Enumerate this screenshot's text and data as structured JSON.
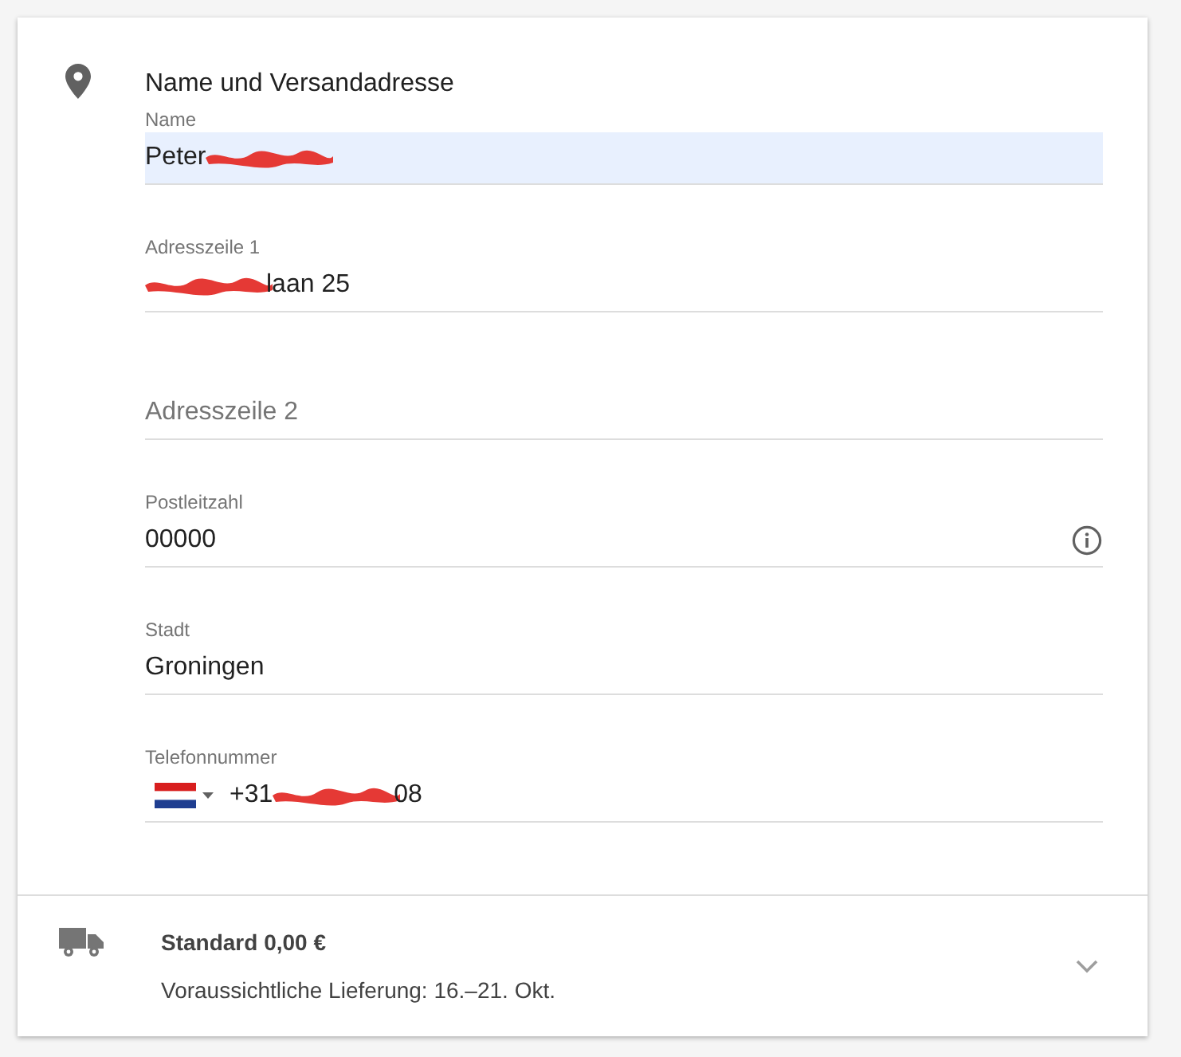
{
  "section": {
    "title": "Name und Versandadresse"
  },
  "fields": [
    {
      "kind": "text",
      "label": "Name",
      "before": "Peter",
      "redacted": true,
      "autofilled": true
    },
    {
      "kind": "text",
      "label": "Adresszeile 1",
      "redacted": true,
      "after": "laan 25",
      "autofilled": false
    },
    {
      "kind": "text",
      "placeholder": "Adresszeile 2",
      "autofilled": false
    },
    {
      "kind": "text",
      "label": "Postleitzahl",
      "before": "00000",
      "autofilled": false,
      "info": true
    },
    {
      "kind": "text",
      "label": "Stadt",
      "before": "Groningen",
      "autofilled": false
    },
    {
      "kind": "phone",
      "label": "Telefonnummer",
      "before": "+31",
      "redacted": true,
      "after": "08",
      "autofilled": false
    }
  ],
  "shipping": {
    "method": "Standard 0,00 €",
    "delivery": "Voraussichtliche Lieferung: 16.–21. Okt.",
    "expanded": false
  }
}
